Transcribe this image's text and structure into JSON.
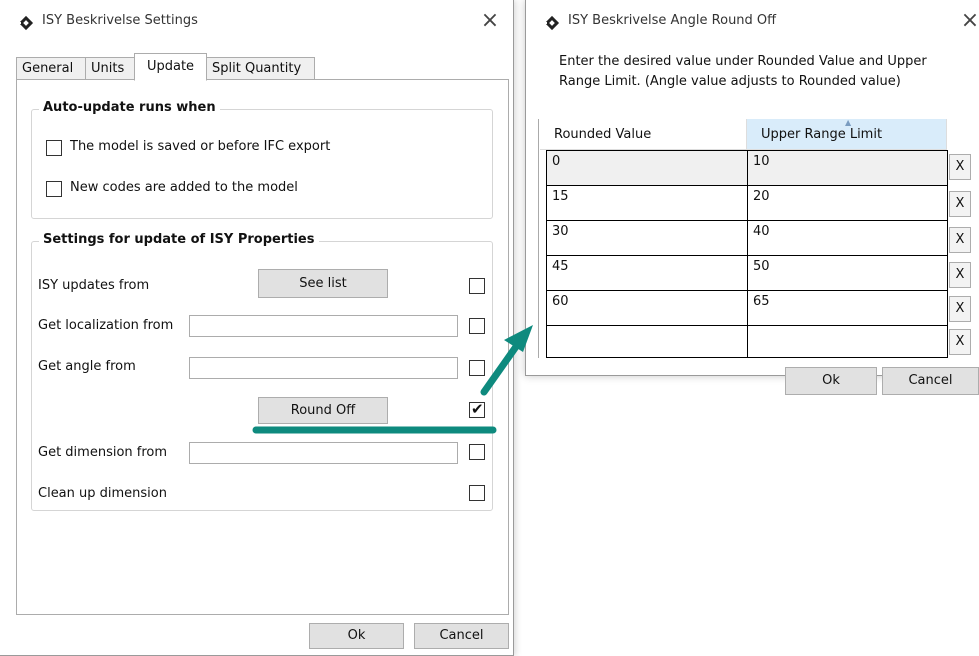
{
  "window1": {
    "title": "ISY Beskrivelse Settings",
    "close_glyph": "×",
    "icon": "app-diamond-icon",
    "tabs": [
      {
        "label": "General"
      },
      {
        "label": "Units"
      },
      {
        "label": "Update"
      },
      {
        "label": "Split Quantity"
      }
    ],
    "active_tab": "Update",
    "auto_update": {
      "title": "Auto-update runs when",
      "options": [
        {
          "label": "The model is saved or before IFC export",
          "checked": false
        },
        {
          "label": "New codes are added to the model",
          "checked": false
        }
      ]
    },
    "isy_settings": {
      "title": "Settings for update of ISY Properties",
      "rows": [
        {
          "label": "ISY updates from",
          "button": "See list",
          "checked": false
        },
        {
          "label": "Get localization from",
          "value": "",
          "checked": false
        },
        {
          "label": "Get angle from",
          "value": "",
          "checked": false
        },
        {
          "button": "Round Off",
          "checked": true
        },
        {
          "label": "Get dimension from",
          "value": "",
          "checked": false
        },
        {
          "label": "Clean up dimension",
          "checked": false
        }
      ],
      "check_glyph": "✔"
    },
    "ok_label": "Ok",
    "cancel_label": "Cancel"
  },
  "window2": {
    "title": "ISY Beskrivelse Angle Round Off",
    "close_glyph": "×",
    "icon": "app-diamond-icon",
    "instructions": "Enter the desired value under Rounded Value and Upper Range Limit. (Angle value adjusts to Rounded value)",
    "columns": [
      "Rounded Value",
      "Upper Range Limit"
    ],
    "rows": [
      {
        "rounded": "0",
        "upper": "10",
        "delete": "X"
      },
      {
        "rounded": "15",
        "upper": "20",
        "delete": "X"
      },
      {
        "rounded": "30",
        "upper": "40",
        "delete": "X"
      },
      {
        "rounded": "45",
        "upper": "50",
        "delete": "X"
      },
      {
        "rounded": "60",
        "upper": "65",
        "delete": "X"
      },
      {
        "rounded": "",
        "upper": "",
        "delete": "X"
      }
    ],
    "ok_label": "Ok",
    "cancel_label": "Cancel"
  },
  "annotation": {
    "color": "#0e8a7e",
    "description_icon": "arrow-annotation"
  }
}
